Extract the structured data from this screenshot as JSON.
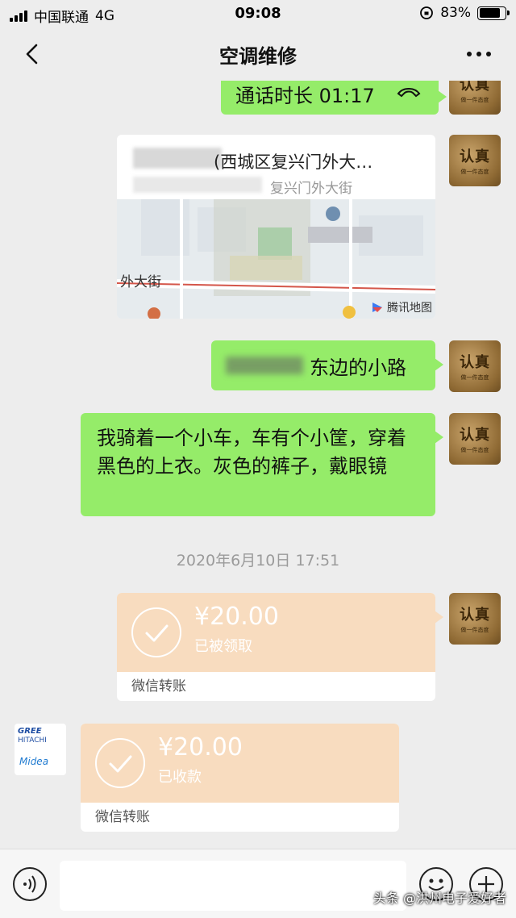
{
  "status_bar": {
    "carrier": "中国联通",
    "network": "4G",
    "time": "09:08",
    "battery": "83%"
  },
  "nav": {
    "title": "空调维修",
    "back_icon": "chevron-left-icon",
    "more_icon": "more-icon"
  },
  "messages": {
    "call": {
      "text": "通话时长 01:17",
      "icon": "phone-hangup-icon"
    },
    "location": {
      "title": "(西城区复兴门外大…",
      "subtitle": "复兴门外大街",
      "map_label": "外大街",
      "attribution": "腾讯地图"
    },
    "road_text": "东边的小路",
    "description": "我骑着一个小车，车有个小筐，穿着黑色的上衣。灰色的裤子，戴眼镜",
    "timestamp": "2020年6月10日 17:51",
    "transfer_out": {
      "amount": "¥20.00",
      "status": "已被领取",
      "label": "微信转账"
    },
    "transfer_in": {
      "amount": "¥20.00",
      "status": "已收款",
      "label": "微信转账"
    }
  },
  "avatars": {
    "self_line1": "认真",
    "self_line2": "做一件态度",
    "brand_line1": "GREE",
    "brand_line2": "HITACHI",
    "brand_line3": "Midea"
  },
  "watermark": "头条 @洪州电子爱好者",
  "colors": {
    "chat_bg": "#ededed",
    "bubble_green": "#95ec69",
    "transfer": "#f8dcbf"
  }
}
